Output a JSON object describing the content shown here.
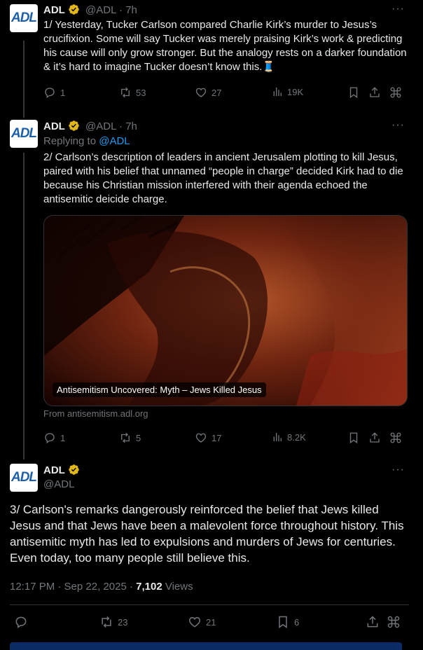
{
  "tweet1": {
    "avatar_text": "ADL",
    "name": "ADL",
    "handle": "@ADL",
    "time": "· 7h",
    "text": "1/ Yesterday, Tucker Carlson compared Charlie Kirk’s murder to Jesus’s crucifixion. Some will say Tucker was merely praising Kirk’s work & predicting his cause will only grow stronger. But the analogy rests on a darker foundation & it’s hard to imagine Tucker doesn’t know this.🧵",
    "stats": {
      "replies": "1",
      "reposts": "53",
      "likes": "27",
      "views": "19K"
    }
  },
  "tweet2": {
    "avatar_text": "ADL",
    "name": "ADL",
    "handle": "@ADL",
    "time": "· 7h",
    "replying_label": "Replying to",
    "replying_to": "@ADL",
    "text": "2/ Carlson’s description of leaders in ancient Jerusalem plotting to kill Jesus, paired with his belief that unnamed “people in charge” decided Kirk had to die because his Christian mission interfered with their agenda echoed the antisemitic deicide charge.",
    "card_title": "Antisemitism Uncovered: Myth – Jews Killed Jesus",
    "card_source": "From antisemitism.adl.org",
    "stats": {
      "replies": "1",
      "reposts": "5",
      "likes": "17",
      "views": "8.2K"
    }
  },
  "tweet3": {
    "avatar_text": "ADL",
    "name": "ADL",
    "handle": "@ADL",
    "text": "3/ Carlson's remarks dangerously reinforced the belief that Jews killed Jesus and that Jews have been a malevolent force throughout history. This antisemitic myth has led to expulsions and murders of Jews for centuries. Even today, too many people still believe this.",
    "timestamp": "12:17 PM · Sep 22, 2025 · ",
    "views_count": "7,102",
    "views_label": " Views",
    "stats": {
      "reposts": "23",
      "likes": "21",
      "bookmarks": "6"
    }
  },
  "more_label": "···"
}
